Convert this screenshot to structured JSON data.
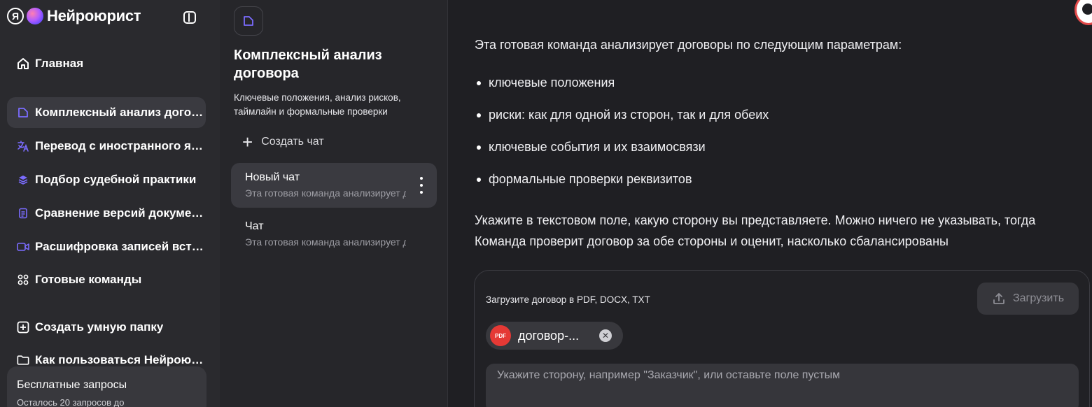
{
  "app": {
    "logo_mark": "Я",
    "brand": "Нейроюрист"
  },
  "sidebar": {
    "items": [
      {
        "label": "Главная",
        "icon": "home-icon"
      },
      {
        "label": "Комплексный анализ договора",
        "icon": "document-icon",
        "active": true
      },
      {
        "label": "Перевод с иностранного языка",
        "icon": "translate-icon"
      },
      {
        "label": "Подбор судебной практики",
        "icon": "layers-icon"
      },
      {
        "label": "Сравнение версий документов",
        "icon": "compare-document-icon"
      },
      {
        "label": "Расшифровка записей встреч",
        "icon": "video-icon"
      },
      {
        "label": "Готовые команды",
        "icon": "grid-icon"
      },
      {
        "label": "Создать умную папку",
        "icon": "plus-square-icon"
      },
      {
        "label": "Как пользоваться Нейроюристом",
        "icon": "folder-icon"
      }
    ],
    "free_requests": {
      "title": "Бесплатные запросы",
      "subtitle": "Осталось 20 запросов до"
    }
  },
  "team": {
    "title": "Комплексный анализ договора",
    "description": "Ключевые положения, анализ рисков, таймлайн и формальные проверки",
    "create_chat": "Создать чат",
    "chats": [
      {
        "name": "Новый чат",
        "preview": "Эта готовая команда анализирует договоры",
        "active": true
      },
      {
        "name": "Чат",
        "preview": "Эта готовая команда анализирует договоры",
        "active": false
      }
    ]
  },
  "content": {
    "intro": "Эта готовая команда анализирует договоры по следующим параметрам:",
    "bullets": [
      "ключевые положения",
      "риски: как для одной из сторон, так и для обеих",
      "ключевые события и их взаимосвязи",
      "формальные проверки реквизитов"
    ],
    "instruction": "Укажите в текстовом поле, какую сторону вы представляете. Можно ничего не указывать, тогда Команда проверит договор за обе стороны и оценит, насколько сбалансированы"
  },
  "upload": {
    "label": "Загрузите договор в PDF, DOCX, TXT",
    "button": "Загрузить",
    "file": {
      "badge": "PDF",
      "name": "договор-..."
    },
    "side_placeholder": "Укажите сторону, например \"Заказчик\", или оставьте поле пустым"
  },
  "colors": {
    "accent": "#7b6cff",
    "pdf": "#e53935",
    "avatar_ring": "#e34a4a"
  }
}
